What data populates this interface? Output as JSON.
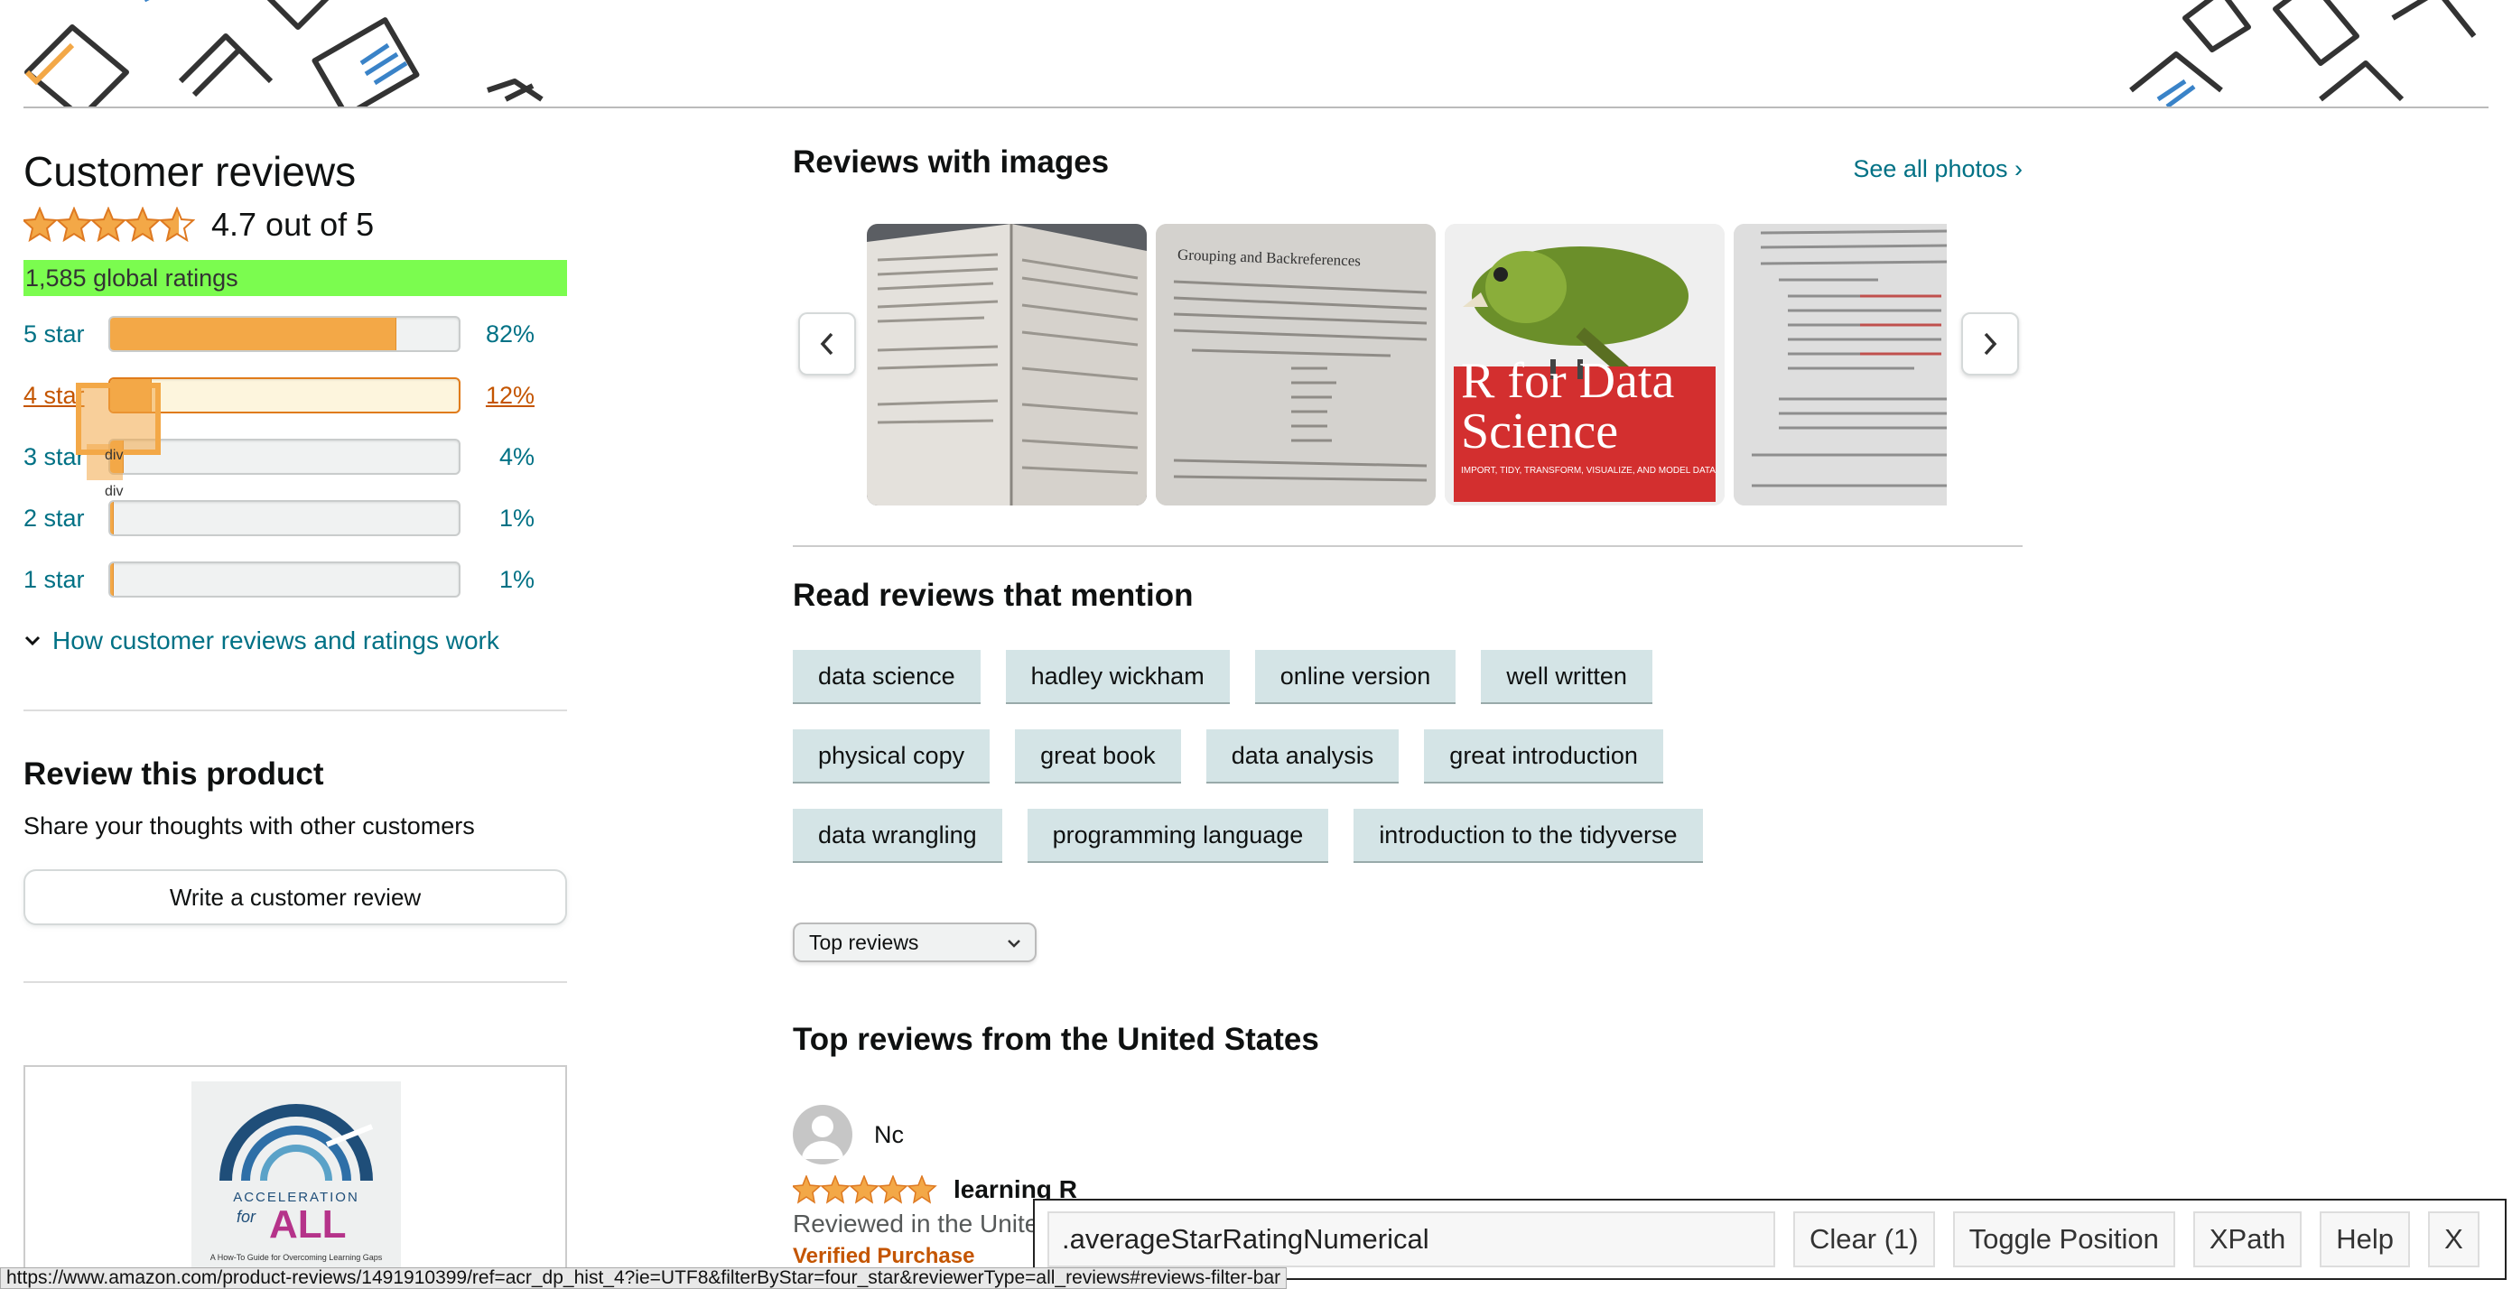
{
  "header": {
    "title": "Customer reviews",
    "rating": 4.7,
    "rating_text": "4.7 out of 5",
    "global_ratings": "1,585 global ratings"
  },
  "histogram": [
    {
      "label": "5 star",
      "pct_text": "82%",
      "pct": 82,
      "active": false
    },
    {
      "label": "4 star",
      "pct_text": "12%",
      "pct": 12,
      "active": true
    },
    {
      "label": "3 star",
      "pct_text": "4%",
      "pct": 4,
      "active": false
    },
    {
      "label": "2 star",
      "pct_text": "1%",
      "pct": 1,
      "active": false
    },
    {
      "label": "1 star",
      "pct_text": "1%",
      "pct": 1,
      "active": false
    }
  ],
  "overlay_tags": [
    "div",
    "div"
  ],
  "how_link": "How customer reviews and ratings work",
  "review_product": {
    "heading": "Review this product",
    "subtext": "Share your thoughts with other customers",
    "button": "Write a customer review"
  },
  "ad": {
    "line1": "ACCELERATION",
    "line2": "for",
    "line3": "ALL",
    "line4": "A How-To Guide for Overcoming Learning Gaps"
  },
  "images_section": {
    "heading": "Reviews with images",
    "see_all": "See all photos ›",
    "thumb3_title1": "R for Data",
    "thumb3_title2": "Science",
    "thumb3_sub": "IMPORT, TIDY, TRANSFORM, VISUALIZE, AND MODEL DATA",
    "thumb2_heading": "Grouping and Backreferences"
  },
  "mention": {
    "heading": "Read reviews that mention",
    "rows": [
      [
        "data science",
        "hadley wickham",
        "online version",
        "well written"
      ],
      [
        "physical copy",
        "great book",
        "data analysis",
        "great introduction"
      ],
      [
        "data wrangling",
        "programming language",
        "introduction to the tidyverse"
      ]
    ]
  },
  "sort": {
    "selected": "Top reviews"
  },
  "top_reviews": {
    "heading": "Top reviews from the United States",
    "first": {
      "user": "Nc",
      "stars": 5,
      "title": "learning R",
      "meta": "Reviewed in the Unite",
      "verified": "Verified Purchase"
    }
  },
  "status_url": "https://www.amazon.com/product-reviews/1491910399/ref=acr_dp_hist_4?ie=UTF8&filterByStar=four_star&reviewerType=all_reviews#reviews-filter-bar",
  "gadget": {
    "selector": ".averageStarRatingNumerical",
    "clear": "Clear (1)",
    "toggle": "Toggle Position",
    "xpath": "XPath",
    "help": "Help",
    "close": "X"
  },
  "colors": {
    "link": "#007185",
    "active_link": "#c45500",
    "star": "#f3a847",
    "highlight_green": "#7bfc4f",
    "chip_bg": "#d4e4e6"
  }
}
